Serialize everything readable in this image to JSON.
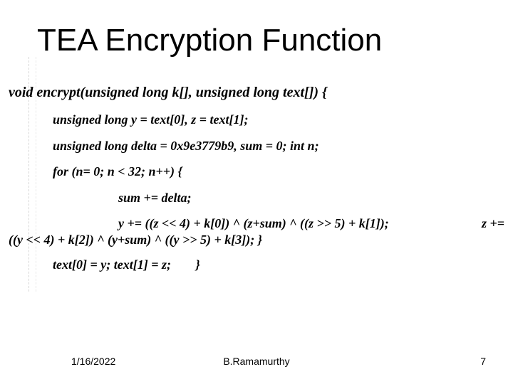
{
  "title": "TEA Encryption Function",
  "code": {
    "sig": "void encrypt(unsigned long k[], unsigned long text[]) {",
    "decl1": "unsigned long y = text[0], z = text[1];",
    "decl2": "unsigned long delta = 0x9e3779b9, sum = 0; int n;",
    "forline": "for (n= 0; n < 32; n++) {",
    "sumline": "sum += delta;",
    "wrap_row1_main": "y += ((z << 4) + k[0]) ^ (z+sum) ^ ((z >> 5) + k[1]);",
    "wrap_row1_tail": "z +=",
    "wrap_row2": "((y << 4) + k[2]) ^ (y+sum) ^ ((y >> 5) + k[3]);           }",
    "assign": "text[0] = y;  text[1] = z;",
    "assign_brace": "}"
  },
  "footer": {
    "date": "1/16/2022",
    "center": "B.Ramamurthy",
    "page": "7"
  }
}
